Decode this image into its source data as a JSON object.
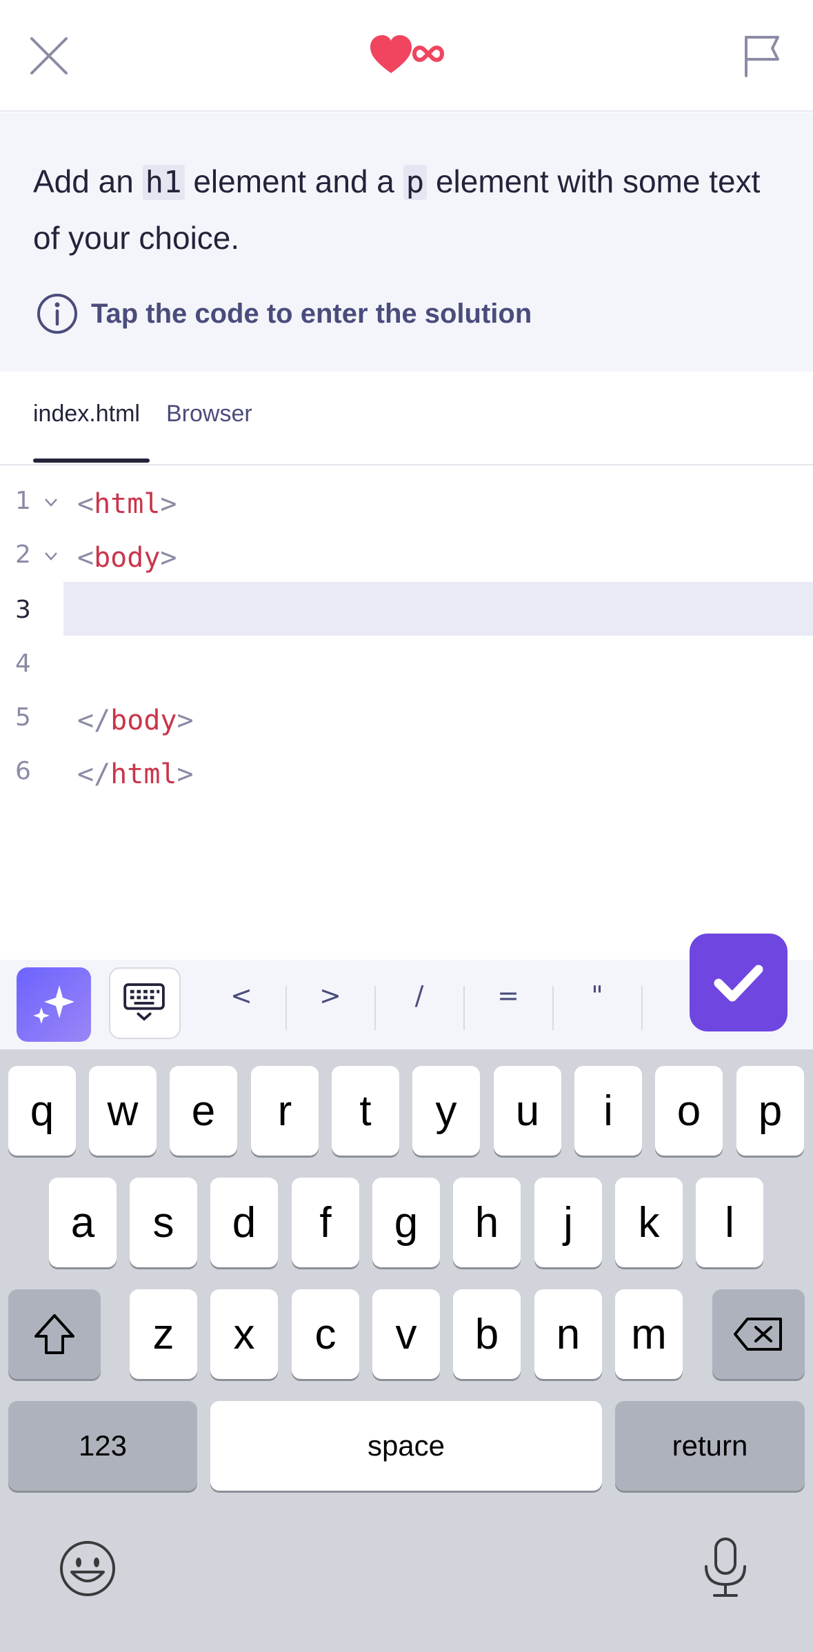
{
  "header": {
    "close_icon": "close-icon",
    "logo_icon": "heart-infinity-logo-icon",
    "flag_icon": "flag-icon",
    "accent_color": "#f0445f"
  },
  "task": {
    "text_part1": "Add an ",
    "chip1": "h1",
    "text_part2": " element and a ",
    "chip2": "p",
    "text_part3": " element with some text of your choice.",
    "hint": "Tap the code to enter the solution",
    "hint_icon": "info-icon"
  },
  "tabs": [
    {
      "label": "index.html",
      "active": true
    },
    {
      "label": "Browser",
      "active": false
    }
  ],
  "editor": {
    "lines": [
      {
        "num": "1",
        "open": "<",
        "tag": "html",
        "close": ">",
        "fold": true
      },
      {
        "num": "2",
        "open": "<",
        "tag": "body",
        "close": ">",
        "fold": true
      },
      {
        "num": "3",
        "open": "",
        "tag": "",
        "close": "",
        "current": true
      },
      {
        "num": "4",
        "open": "",
        "tag": "",
        "close": ""
      },
      {
        "num": "5",
        "open": "</",
        "tag": "body",
        "close": ">"
      },
      {
        "num": "6",
        "open": "</",
        "tag": "html",
        "close": ">"
      }
    ]
  },
  "accessory": {
    "ai_icon": "sparkles-icon",
    "keyboard_icon": "keyboard-hide-icon",
    "symbols": [
      "<",
      ">",
      "/",
      "=",
      "\""
    ],
    "check_icon": "checkmark-icon",
    "check_color": "#6f46e0"
  },
  "keyboard": {
    "row1": [
      "q",
      "w",
      "e",
      "r",
      "t",
      "y",
      "u",
      "i",
      "o",
      "p"
    ],
    "row2": [
      "a",
      "s",
      "d",
      "f",
      "g",
      "h",
      "j",
      "k",
      "l"
    ],
    "row3": [
      "z",
      "x",
      "c",
      "v",
      "b",
      "n",
      "m"
    ],
    "numbers_label": "123",
    "space_label": "space",
    "return_label": "return",
    "shift_icon": "shift-icon",
    "delete_icon": "backspace-icon",
    "emoji_icon": "emoji-icon",
    "mic_icon": "microphone-icon"
  }
}
